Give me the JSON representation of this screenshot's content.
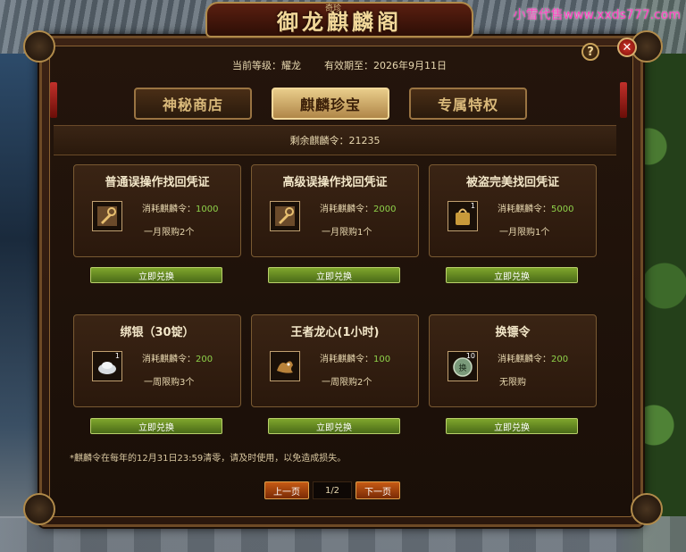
{
  "watermark": "小雪代售www.xxds777.com",
  "header": {
    "title": "御龙麒麟阁",
    "subtitle": "奇珍"
  },
  "info": {
    "level_label": "当前等级：耀龙",
    "expire_label": "有效期至：2026年9月11日"
  },
  "tabs": [
    {
      "label": "神秘商店",
      "active": false
    },
    {
      "label": "麒麟珍宝",
      "active": true
    },
    {
      "label": "专属特权",
      "active": false
    }
  ],
  "remaining": "剩余麒麟令：21235",
  "items": [
    {
      "title": "普通误操作找回凭证",
      "icon": "wrench-icon",
      "cost_label": "消耗麒麟令：",
      "cost": "1000",
      "limit": "一月限购2个",
      "qty": "",
      "button": "立即兑换"
    },
    {
      "title": "高级误操作找回凭证",
      "icon": "wrench-icon",
      "cost_label": "消耗麒麟令：",
      "cost": "2000",
      "limit": "一月限购1个",
      "qty": "",
      "button": "立即兑换"
    },
    {
      "title": "被盗完美找回凭证",
      "icon": "bag-icon",
      "cost_label": "消耗麒麟令：",
      "cost": "5000",
      "limit": "一月限购1个",
      "qty": "1",
      "button": "立即兑换"
    },
    {
      "title": "绑银（30锭）",
      "icon": "silver-ingot-icon",
      "cost_label": "消耗麒麟令：",
      "cost": "200",
      "limit": "一周限购3个",
      "qty": "1",
      "button": "立即兑换"
    },
    {
      "title": "王者龙心(1小时)",
      "icon": "dragon-icon",
      "cost_label": "消耗麒麟令：",
      "cost": "100",
      "limit": "一周限购2个",
      "qty": "",
      "button": "立即兑换"
    },
    {
      "title": "换镖令",
      "icon": "token-icon",
      "cost_label": "消耗麒麟令：",
      "cost": "200",
      "limit": "无限购",
      "qty": "10",
      "button": "立即兑换"
    }
  ],
  "note": "*麒麟令在每年的12月31日23:59清零，请及时使用，以免造成损失。",
  "pager": {
    "prev": "上一页",
    "page": "1/2",
    "next": "下一页"
  },
  "help_label": "?",
  "close_label": "✕"
}
